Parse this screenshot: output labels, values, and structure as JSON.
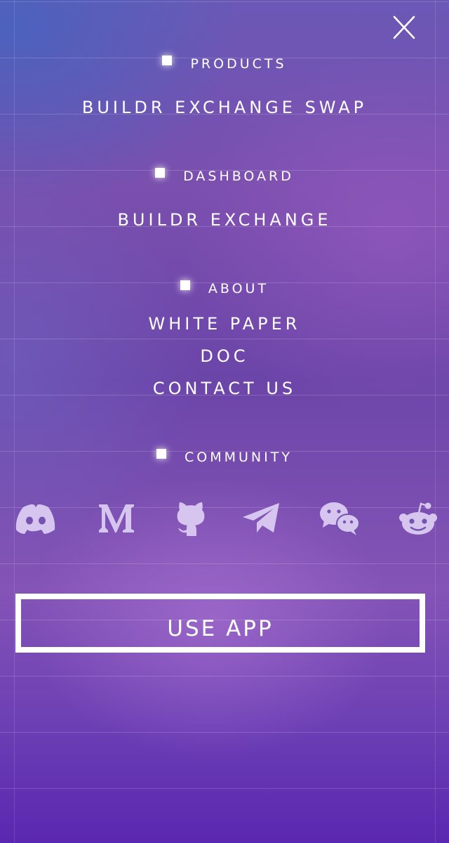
{
  "menu": {
    "close_icon": "close-icon",
    "sections": {
      "products": {
        "title": "PRODUCTS",
        "links": [
          "BUILDR EXCHANGE SWAP"
        ]
      },
      "dashboard": {
        "title": "DASHBOARD",
        "links": [
          "BUILDR EXCHANGE"
        ]
      },
      "about": {
        "title": "ABOUT",
        "links": [
          "WHITE PAPER",
          "DOC",
          "CONTACT US"
        ]
      },
      "community": {
        "title": "COMMUNITY",
        "icons": [
          "discord-icon",
          "medium-icon",
          "github-icon",
          "telegram-icon",
          "wechat-icon",
          "reddit-icon"
        ]
      }
    },
    "cta_label": "USE APP"
  },
  "colors": {
    "text": "#ffffff",
    "icon": "#d6c6ef",
    "background_top": "#6b58b6",
    "background_bottom": "#5a27b0"
  }
}
